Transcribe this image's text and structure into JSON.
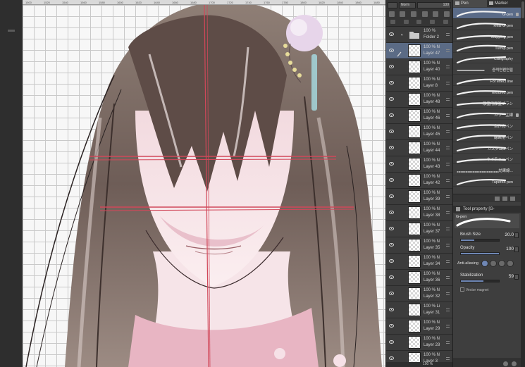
{
  "ruler": {
    "ticks": [
      "1500",
      "1520",
      "1540",
      "1560",
      "1580",
      "1600",
      "1620",
      "1640",
      "1660",
      "1680",
      "1700",
      "1720",
      "1740",
      "1760",
      "1780",
      "1800",
      "1820",
      "1840",
      "1860",
      "1880",
      "1900"
    ]
  },
  "layer_panel": {
    "blend_mode": "Norm",
    "opacity": "100",
    "layers": [
      {
        "percent": "100 %",
        "name": "Folder 2",
        "type": "folder",
        "selected": false
      },
      {
        "percent": "100 % N",
        "name": "Layer 47",
        "type": "raster",
        "selected": true
      },
      {
        "percent": "100 % N",
        "name": "Layer 40",
        "type": "raster",
        "selected": false
      },
      {
        "percent": "100 % N",
        "name": "Layer 8",
        "type": "raster",
        "selected": false
      },
      {
        "percent": "100 % N",
        "name": "Layer 48",
        "type": "raster",
        "selected": false
      },
      {
        "percent": "100 % N",
        "name": "Layer 46",
        "type": "raster",
        "selected": false
      },
      {
        "percent": "100 % N",
        "name": "Layer 45",
        "type": "raster",
        "selected": false
      },
      {
        "percent": "100 % N",
        "name": "Layer 44",
        "type": "raster",
        "selected": false
      },
      {
        "percent": "100 % N",
        "name": "Layer 43",
        "type": "raster",
        "selected": false
      },
      {
        "percent": "100 % N",
        "name": "Layer 42",
        "type": "raster",
        "selected": false
      },
      {
        "percent": "100 % N",
        "name": "Layer 39",
        "type": "raster",
        "selected": false
      },
      {
        "percent": "100 % N",
        "name": "Layer 38",
        "type": "raster",
        "selected": false
      },
      {
        "percent": "100 % N",
        "name": "Layer 37",
        "type": "raster",
        "selected": false
      },
      {
        "percent": "100 % N",
        "name": "Layer 35",
        "type": "raster",
        "selected": false
      },
      {
        "percent": "100 % N",
        "name": "Layer 34",
        "type": "raster",
        "selected": false
      },
      {
        "percent": "100 % N",
        "name": "Layer 36",
        "type": "raster",
        "selected": false
      },
      {
        "percent": "100 % N",
        "name": "Layer 32",
        "type": "raster",
        "selected": false
      },
      {
        "percent": "100 % Li",
        "name": "Layer 31",
        "type": "raster",
        "selected": false
      },
      {
        "percent": "100 % N",
        "name": "Layer 29",
        "type": "raster",
        "selected": false
      },
      {
        "percent": "100 % N",
        "name": "Layer 28",
        "type": "raster",
        "selected": false
      },
      {
        "percent": "100 % N",
        "name": "Layer 3",
        "type": "raster",
        "selected": false
      }
    ],
    "footer": "100 %"
  },
  "brush_panel": {
    "tabs": [
      {
        "label": "Pen",
        "active": true
      },
      {
        "label": "Marker",
        "active": false
      }
    ],
    "brushes": [
      {
        "name": "G-pen",
        "selected": true,
        "locked": true
      },
      {
        "name": "Real G-pen",
        "selected": false,
        "locked": false
      },
      {
        "name": "Mapping pen",
        "selected": false,
        "locked": false
      },
      {
        "name": "Turnip pen",
        "selected": false,
        "locked": false
      },
      {
        "name": "Calligraphy",
        "selected": false,
        "locked": false
      },
      {
        "name": "중력연펜연필",
        "selected": false,
        "locked": false
      },
      {
        "name": "For effect line",
        "selected": false,
        "locked": false
      },
      {
        "name": "Textured pen",
        "selected": false,
        "locked": false
      },
      {
        "name": "厚塗用厚塗ブラシ",
        "selected": false,
        "locked": false
      },
      {
        "name": "カラー主線",
        "selected": false,
        "locked": true
      },
      {
        "name": "自作丸ペン",
        "selected": false,
        "locked": false
      },
      {
        "name": "線画用ペン",
        "selected": false,
        "locked": false
      },
      {
        "name": "カスタムGペン",
        "selected": false,
        "locked": false
      },
      {
        "name": "ネイチャーペン",
        "selected": false,
        "locked": false
      },
      {
        "name": "効果線...",
        "selected": false,
        "locked": false
      },
      {
        "name": "Tapered pen",
        "selected": false,
        "locked": false
      }
    ]
  },
  "tool_property": {
    "header": "Tool property [G-",
    "preview_label": "G-pen",
    "brush_size": {
      "label": "Brush Size",
      "value": "20.0",
      "fill_fraction": 0.35
    },
    "opacity": {
      "label": "Opacity",
      "value": "100",
      "fill_fraction": 1.0
    },
    "anti_aliasing": {
      "label": "Anti-aliasing",
      "selected_index": 0
    },
    "stabilization": {
      "label": "Stabilization",
      "value": "59",
      "fill_fraction": 0.59
    },
    "vector_magnet": {
      "label": "Vector magnet"
    }
  },
  "colors": {
    "selection": "#5b6b85",
    "accent": "#6f87b5",
    "guide_red": "#d1485a"
  }
}
